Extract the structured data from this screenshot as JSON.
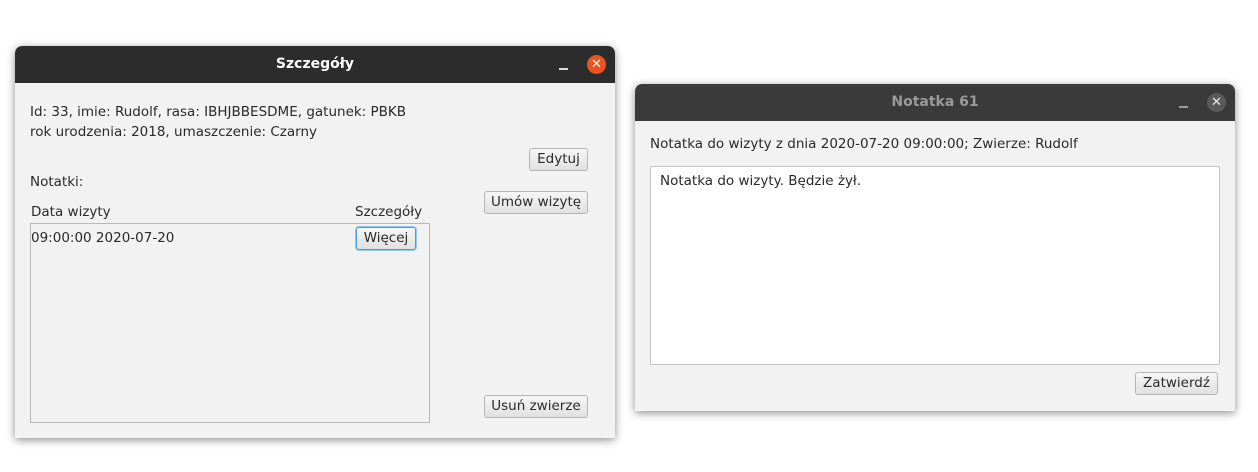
{
  "details_window": {
    "title": "Szczegóły",
    "info_line1": "Id: 33, imie: Rudolf, rasa: IBHJBBESDME, gatunek: PBKB",
    "info_line2": "rok urodzenia: 2018, umaszczenie: Czarny",
    "notes_label": "Notatki:",
    "edit_button": "Edytuj",
    "schedule_button": "Umów wizytę",
    "delete_button": "Usuń zwierze",
    "table": {
      "col_date": "Data wizyty",
      "col_details": "Szczegóły",
      "rows": [
        {
          "date": "09:00:00 2020-07-20",
          "button": "Więcej"
        }
      ]
    }
  },
  "note_window": {
    "title": "Notatka 61",
    "header_text": "Notatka do wizyty z dnia 2020-07-20 09:00:00; Zwierze: Rudolf",
    "note_content": "Notatka do wizyty. Będzie żył.",
    "confirm_button": "Zatwierdź"
  },
  "icons": {
    "close": "close-icon",
    "minimize": "minimize-icon"
  },
  "colors": {
    "close_active": "#e95420",
    "titlebar": "#2c2c2c",
    "window_bg": "#f2f2f2",
    "focus": "#4a9fd8"
  }
}
